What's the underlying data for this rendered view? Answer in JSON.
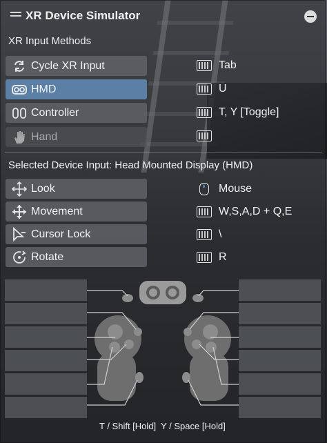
{
  "title": "XR Device Simulator",
  "input_methods_label": "XR Input Methods",
  "methods": [
    {
      "label": "Cycle XR Input",
      "icon": "cycle-icon",
      "key_icon": "keyboard-icon",
      "key": "Tab"
    },
    {
      "label": "HMD",
      "icon": "hmd-icon",
      "key_icon": "keyboard-icon",
      "key": "U",
      "selected": true
    },
    {
      "label": "Controller",
      "icon": "controller-icon",
      "key_icon": "keyboard-icon",
      "key": "T, Y [Toggle]"
    },
    {
      "label": "Hand",
      "icon": "hand-icon",
      "key_icon": "keyboard-icon",
      "key": "",
      "disabled": true
    }
  ],
  "selected_device_label": "Selected Device Input: Head Mounted Display (HMD)",
  "device_inputs": [
    {
      "label": "Look",
      "icon": "look-icon",
      "key_icon": "mouse-icon",
      "key": "Mouse"
    },
    {
      "label": "Movement",
      "icon": "movement-icon",
      "key_icon": "keyboard-icon",
      "key": "W,S,A,D + Q,E"
    },
    {
      "label": "Cursor Lock",
      "icon": "cursor-lock-icon",
      "key_icon": "keyboard-icon",
      "key": "\\"
    },
    {
      "label": "Rotate",
      "icon": "rotate-icon",
      "key_icon": "keyboard-icon",
      "key": "R"
    }
  ],
  "footer_hint": "T / Shift [Hold]  Y / Space [Hold]",
  "colors": {
    "accent": "#5c7fa5",
    "button": "#5f6166",
    "panel": "#2a2c30"
  }
}
